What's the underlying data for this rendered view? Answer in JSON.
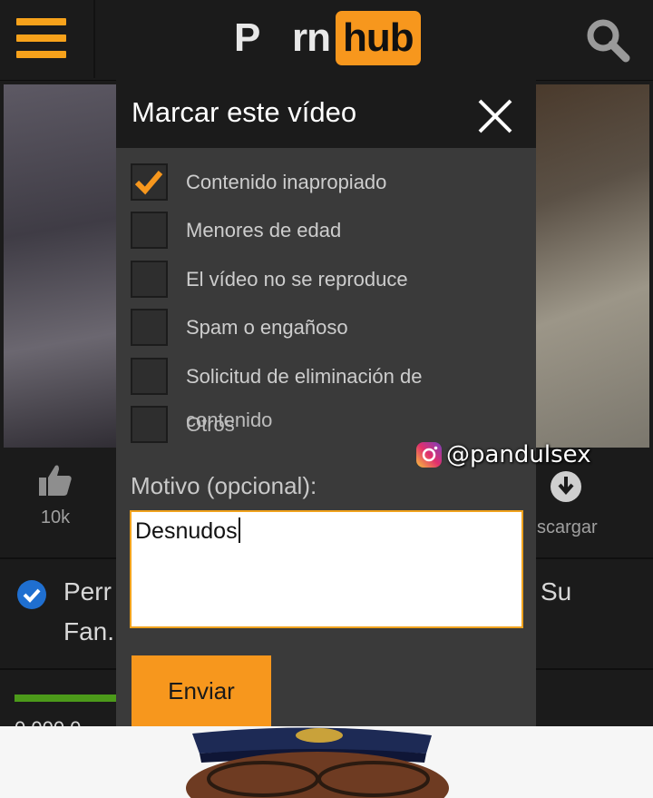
{
  "header": {
    "logo_p": "P",
    "logo_rn": "rn",
    "logo_hub": "hub",
    "menu_icon": "hamburger-menu-icon",
    "search_icon": "search-icon",
    "accent": "#f7971d"
  },
  "video": {
    "like_count": "10k",
    "download_label": "scargar",
    "title_left": "Perr",
    "title_right": "Su",
    "title_line2": "Fan.",
    "views_partial": "0.000.0"
  },
  "modal": {
    "title": "Marcar este vídeo",
    "close_icon": "close-icon",
    "options": [
      {
        "label": "Contenido inapropiado",
        "checked": true
      },
      {
        "label": "Menores de edad",
        "checked": false
      },
      {
        "label": "El vídeo no se reproduce",
        "checked": false
      },
      {
        "label": "Spam o engañoso",
        "checked": false
      },
      {
        "label": "Solicitud de eliminación de",
        "checked": false
      },
      {
        "label": "Otros",
        "checked": false
      }
    ],
    "option_overflow_text": "contenido",
    "motivo_label": "Motivo (opcional):",
    "motivo_value": "Desnudos",
    "send_label": "Enviar"
  },
  "watermark": {
    "icon": "instagram-icon",
    "handle": "@pandulsex"
  }
}
